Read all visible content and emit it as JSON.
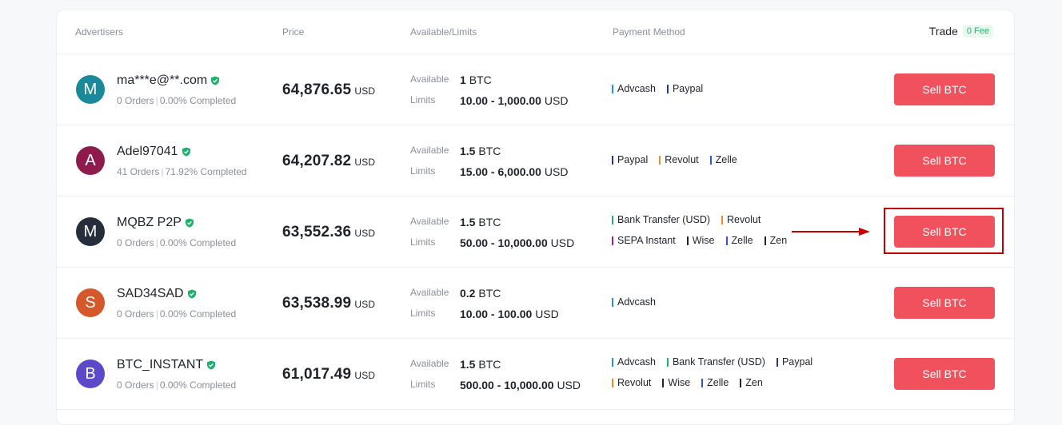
{
  "header": {
    "advertisers": "Advertisers",
    "price": "Price",
    "available_limits": "Available/Limits",
    "payment_method": "Payment Method",
    "trade": "Trade",
    "fee": "0 Fee"
  },
  "labels": {
    "available": "Available",
    "limits": "Limits"
  },
  "rows": [
    {
      "initial": "M",
      "avatar_color": "#1a8a9a",
      "name": "ma***e@**.com",
      "orders": "0 Orders",
      "completed": "0.00% Completed",
      "price": "64,876.65",
      "currency": "USD",
      "available_amount": "1",
      "available_unit": "BTC",
      "limits_range": "10.00 - 1,000.00",
      "limits_unit": "USD",
      "payments": [
        [
          {
            "name": "Advcash",
            "color": "#2a8fd0"
          },
          {
            "name": "Paypal",
            "color": "#1f3b8a"
          }
        ]
      ],
      "button": "Sell BTC"
    },
    {
      "initial": "A",
      "avatar_color": "#8e1b4c",
      "name": "Adel97041",
      "orders": "41 Orders",
      "completed": "71.92% Completed",
      "price": "64,207.82",
      "currency": "USD",
      "available_amount": "1.5",
      "available_unit": "BTC",
      "limits_range": "15.00 - 6,000.00",
      "limits_unit": "USD",
      "payments": [
        [
          {
            "name": "Paypal",
            "color": "#1f3b8a"
          },
          {
            "name": "Revolut",
            "color": "#f08a24"
          },
          {
            "name": "Zelle",
            "color": "#3556c9"
          }
        ]
      ],
      "button": "Sell BTC"
    },
    {
      "initial": "M",
      "avatar_color": "#252e3a",
      "name": "MQBZ P2P",
      "orders": "0 Orders",
      "completed": "0.00% Completed",
      "price": "63,552.36",
      "currency": "USD",
      "available_amount": "1.5",
      "available_unit": "BTC",
      "limits_range": "50.00 - 10,000.00",
      "limits_unit": "USD",
      "payments": [
        [
          {
            "name": "Bank Transfer (USD)",
            "color": "#20b26c"
          },
          {
            "name": "Revolut",
            "color": "#f08a24"
          }
        ],
        [
          {
            "name": "SEPA Instant",
            "color": "#a0208a"
          },
          {
            "name": "Wise",
            "color": "#1e2329"
          },
          {
            "name": "Zelle",
            "color": "#3556c9"
          },
          {
            "name": "Zen",
            "color": "#1e2329"
          }
        ]
      ],
      "button": "Sell BTC"
    },
    {
      "initial": "S",
      "avatar_color": "#d4582a",
      "name": "SAD34SAD",
      "orders": "0 Orders",
      "completed": "0.00% Completed",
      "price": "63,538.99",
      "currency": "USD",
      "available_amount": "0.2",
      "available_unit": "BTC",
      "limits_range": "10.00 - 100.00",
      "limits_unit": "USD",
      "payments": [
        [
          {
            "name": "Advcash",
            "color": "#2a8fd0"
          }
        ]
      ],
      "button": "Sell BTC"
    },
    {
      "initial": "B",
      "avatar_color": "#5b49c9",
      "name": "BTC_INSTANT",
      "orders": "0 Orders",
      "completed": "0.00% Completed",
      "price": "61,017.49",
      "currency": "USD",
      "available_amount": "1.5",
      "available_unit": "BTC",
      "limits_range": "500.00 - 10,000.00",
      "limits_unit": "USD",
      "payments": [
        [
          {
            "name": "Advcash",
            "color": "#2a8fd0"
          },
          {
            "name": "Bank Transfer (USD)",
            "color": "#20b26c"
          },
          {
            "name": "Paypal",
            "color": "#1f3b8a"
          }
        ],
        [
          {
            "name": "Revolut",
            "color": "#f08a24"
          },
          {
            "name": "Wise",
            "color": "#1e2329"
          },
          {
            "name": "Zelle",
            "color": "#3556c9"
          },
          {
            "name": "Zen",
            "color": "#1e2329"
          }
        ]
      ],
      "button": "Sell BTC"
    }
  ],
  "colors": {
    "sell_button": "#f0515d",
    "highlight": "#c40000",
    "verified": "#20b26c"
  }
}
